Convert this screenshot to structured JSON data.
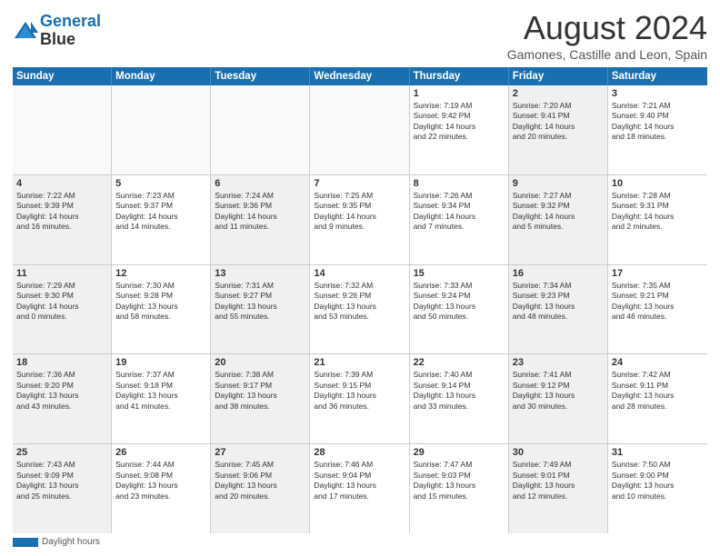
{
  "header": {
    "logo_line1": "General",
    "logo_line2": "Blue",
    "month": "August 2024",
    "location": "Gamones, Castille and Leon, Spain"
  },
  "weekdays": [
    "Sunday",
    "Monday",
    "Tuesday",
    "Wednesday",
    "Thursday",
    "Friday",
    "Saturday"
  ],
  "footer_label": "Daylight hours",
  "rows": [
    [
      {
        "day": "",
        "info": "",
        "shaded": false,
        "empty": true
      },
      {
        "day": "",
        "info": "",
        "shaded": false,
        "empty": true
      },
      {
        "day": "",
        "info": "",
        "shaded": false,
        "empty": true
      },
      {
        "day": "",
        "info": "",
        "shaded": false,
        "empty": true
      },
      {
        "day": "1",
        "info": "Sunrise: 7:19 AM\nSunset: 9:42 PM\nDaylight: 14 hours\nand 22 minutes.",
        "shaded": false,
        "empty": false
      },
      {
        "day": "2",
        "info": "Sunrise: 7:20 AM\nSunset: 9:41 PM\nDaylight: 14 hours\nand 20 minutes.",
        "shaded": true,
        "empty": false
      },
      {
        "day": "3",
        "info": "Sunrise: 7:21 AM\nSunset: 9:40 PM\nDaylight: 14 hours\nand 18 minutes.",
        "shaded": false,
        "empty": false
      }
    ],
    [
      {
        "day": "4",
        "info": "Sunrise: 7:22 AM\nSunset: 9:39 PM\nDaylight: 14 hours\nand 16 minutes.",
        "shaded": true,
        "empty": false
      },
      {
        "day": "5",
        "info": "Sunrise: 7:23 AM\nSunset: 9:37 PM\nDaylight: 14 hours\nand 14 minutes.",
        "shaded": false,
        "empty": false
      },
      {
        "day": "6",
        "info": "Sunrise: 7:24 AM\nSunset: 9:36 PM\nDaylight: 14 hours\nand 11 minutes.",
        "shaded": true,
        "empty": false
      },
      {
        "day": "7",
        "info": "Sunrise: 7:25 AM\nSunset: 9:35 PM\nDaylight: 14 hours\nand 9 minutes.",
        "shaded": false,
        "empty": false
      },
      {
        "day": "8",
        "info": "Sunrise: 7:26 AM\nSunset: 9:34 PM\nDaylight: 14 hours\nand 7 minutes.",
        "shaded": false,
        "empty": false
      },
      {
        "day": "9",
        "info": "Sunrise: 7:27 AM\nSunset: 9:32 PM\nDaylight: 14 hours\nand 5 minutes.",
        "shaded": true,
        "empty": false
      },
      {
        "day": "10",
        "info": "Sunrise: 7:28 AM\nSunset: 9:31 PM\nDaylight: 14 hours\nand 2 minutes.",
        "shaded": false,
        "empty": false
      }
    ],
    [
      {
        "day": "11",
        "info": "Sunrise: 7:29 AM\nSunset: 9:30 PM\nDaylight: 14 hours\nand 0 minutes.",
        "shaded": true,
        "empty": false
      },
      {
        "day": "12",
        "info": "Sunrise: 7:30 AM\nSunset: 9:28 PM\nDaylight: 13 hours\nand 58 minutes.",
        "shaded": false,
        "empty": false
      },
      {
        "day": "13",
        "info": "Sunrise: 7:31 AM\nSunset: 9:27 PM\nDaylight: 13 hours\nand 55 minutes.",
        "shaded": true,
        "empty": false
      },
      {
        "day": "14",
        "info": "Sunrise: 7:32 AM\nSunset: 9:26 PM\nDaylight: 13 hours\nand 53 minutes.",
        "shaded": false,
        "empty": false
      },
      {
        "day": "15",
        "info": "Sunrise: 7:33 AM\nSunset: 9:24 PM\nDaylight: 13 hours\nand 50 minutes.",
        "shaded": false,
        "empty": false
      },
      {
        "day": "16",
        "info": "Sunrise: 7:34 AM\nSunset: 9:23 PM\nDaylight: 13 hours\nand 48 minutes.",
        "shaded": true,
        "empty": false
      },
      {
        "day": "17",
        "info": "Sunrise: 7:35 AM\nSunset: 9:21 PM\nDaylight: 13 hours\nand 46 minutes.",
        "shaded": false,
        "empty": false
      }
    ],
    [
      {
        "day": "18",
        "info": "Sunrise: 7:36 AM\nSunset: 9:20 PM\nDaylight: 13 hours\nand 43 minutes.",
        "shaded": true,
        "empty": false
      },
      {
        "day": "19",
        "info": "Sunrise: 7:37 AM\nSunset: 9:18 PM\nDaylight: 13 hours\nand 41 minutes.",
        "shaded": false,
        "empty": false
      },
      {
        "day": "20",
        "info": "Sunrise: 7:38 AM\nSunset: 9:17 PM\nDaylight: 13 hours\nand 38 minutes.",
        "shaded": true,
        "empty": false
      },
      {
        "day": "21",
        "info": "Sunrise: 7:39 AM\nSunset: 9:15 PM\nDaylight: 13 hours\nand 36 minutes.",
        "shaded": false,
        "empty": false
      },
      {
        "day": "22",
        "info": "Sunrise: 7:40 AM\nSunset: 9:14 PM\nDaylight: 13 hours\nand 33 minutes.",
        "shaded": false,
        "empty": false
      },
      {
        "day": "23",
        "info": "Sunrise: 7:41 AM\nSunset: 9:12 PM\nDaylight: 13 hours\nand 30 minutes.",
        "shaded": true,
        "empty": false
      },
      {
        "day": "24",
        "info": "Sunrise: 7:42 AM\nSunset: 9:11 PM\nDaylight: 13 hours\nand 28 minutes.",
        "shaded": false,
        "empty": false
      }
    ],
    [
      {
        "day": "25",
        "info": "Sunrise: 7:43 AM\nSunset: 9:09 PM\nDaylight: 13 hours\nand 25 minutes.",
        "shaded": true,
        "empty": false
      },
      {
        "day": "26",
        "info": "Sunrise: 7:44 AM\nSunset: 9:08 PM\nDaylight: 13 hours\nand 23 minutes.",
        "shaded": false,
        "empty": false
      },
      {
        "day": "27",
        "info": "Sunrise: 7:45 AM\nSunset: 9:06 PM\nDaylight: 13 hours\nand 20 minutes.",
        "shaded": true,
        "empty": false
      },
      {
        "day": "28",
        "info": "Sunrise: 7:46 AM\nSunset: 9:04 PM\nDaylight: 13 hours\nand 17 minutes.",
        "shaded": false,
        "empty": false
      },
      {
        "day": "29",
        "info": "Sunrise: 7:47 AM\nSunset: 9:03 PM\nDaylight: 13 hours\nand 15 minutes.",
        "shaded": false,
        "empty": false
      },
      {
        "day": "30",
        "info": "Sunrise: 7:49 AM\nSunset: 9:01 PM\nDaylight: 13 hours\nand 12 minutes.",
        "shaded": true,
        "empty": false
      },
      {
        "day": "31",
        "info": "Sunrise: 7:50 AM\nSunset: 9:00 PM\nDaylight: 13 hours\nand 10 minutes.",
        "shaded": false,
        "empty": false
      }
    ]
  ]
}
